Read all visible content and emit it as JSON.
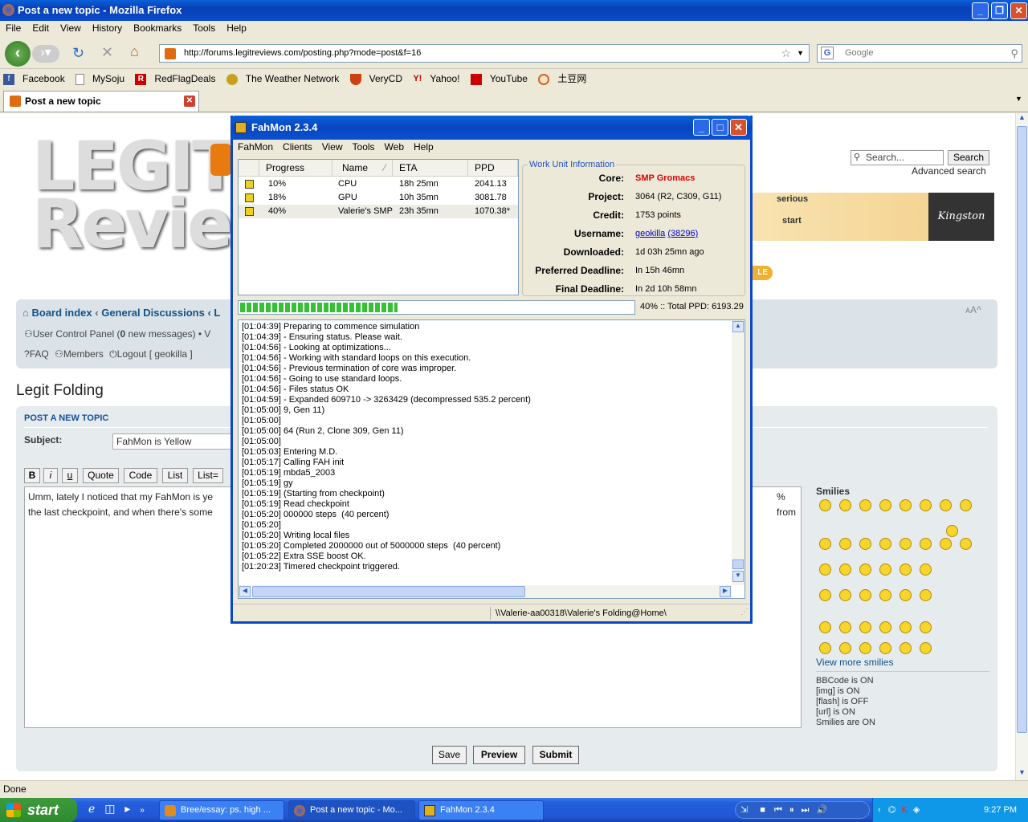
{
  "browser": {
    "title": "Post a new topic - Mozilla Firefox",
    "menu": [
      "File",
      "Edit",
      "View",
      "History",
      "Bookmarks",
      "Tools",
      "Help"
    ],
    "url": "http://forums.legitreviews.com/posting.php?mode=post&f=16",
    "search_placeholder": "Google",
    "bookmarks": [
      "Facebook",
      "MySoju",
      "RedFlagDeals",
      "The Weather Network",
      "VeryCD",
      "Yahoo!",
      "YouTube",
      "土豆网"
    ],
    "tab": "Post a new topic",
    "status": "Done"
  },
  "page": {
    "search_placeholder": "Search...",
    "search_button": "Search",
    "advanced_search": "Advanced search",
    "breadcrumb_board": "Board index",
    "breadcrumb_sep": "‹",
    "breadcrumb_general": "General Discussions",
    "breadcrumb_tail": "‹ L",
    "ucp_prefix": "User Control Panel (",
    "ucp_count": "0",
    "ucp_suffix": " new messages) • V",
    "faq": "FAQ",
    "members": "Members",
    "logout": "Logout [ geokilla ]",
    "forum_title": "Legit Folding",
    "post_heading": "POST A NEW TOPIC",
    "subject_label": "Subject:",
    "subject_value": "FahMon is Yellow",
    "bbcode_buttons": [
      "B",
      "i",
      "u",
      "Quote",
      "Code",
      "List",
      "List="
    ],
    "message_line1": "Umm, lately I noticed that my FahMon is ye",
    "message_line1_right": "% from",
    "message_line2": "the last checkpoint, and when there's some",
    "smilies_title": "Smilies",
    "view_more_smilies": "View more smilies",
    "bbcode_status": "BBCode is ON",
    "img_status": "[img] is ON",
    "flash_status": "[flash] is OFF",
    "url_status": "[url] is ON",
    "smilies_status": "Smilies are ON",
    "save": "Save",
    "preview": "Preview",
    "submit": "Submit",
    "ad_text1": "serious",
    "ad_text2": "start",
    "ad_brand": "Kingston"
  },
  "fahmon": {
    "title": "FahMon 2.3.4",
    "menu": [
      "FahMon",
      "Clients",
      "View",
      "Tools",
      "Web",
      "Help"
    ],
    "columns": [
      "Progress",
      "Name",
      "ETA",
      "PPD"
    ],
    "clients": [
      {
        "progress": "10%",
        "name": "CPU",
        "eta": "18h 25mn",
        "ppd": "2041.13"
      },
      {
        "progress": "18%",
        "name": "GPU",
        "eta": "10h 35mn",
        "ppd": "3081.78"
      },
      {
        "progress": "40%",
        "name": "Valerie's SMP",
        "eta": "23h 35mn",
        "ppd": "1070.38*"
      }
    ],
    "wu_title": "Work Unit Information",
    "wu": [
      {
        "label": "Core:",
        "value": "SMP Gromacs"
      },
      {
        "label": "Project:",
        "value": "3064 (R2, C309, G11)"
      },
      {
        "label": "Credit:",
        "value": "1753 points"
      },
      {
        "label": "Username:",
        "value": "geokilla",
        "extra": "(38296)"
      },
      {
        "label": "Downloaded:",
        "value": "1d 03h 25mn ago"
      },
      {
        "label": "Preferred Deadline:",
        "value": "In 15h 46mn"
      },
      {
        "label": "Final Deadline:",
        "value": "In 2d 10h 58mn"
      }
    ],
    "progress_fraction": 0.4,
    "progress_text": "40% :: Total PPD: 6193.29",
    "log": "[01:04:39] Preparing to commence simulation\n[01:04:39] - Ensuring status. Please wait.\n[01:04:56] - Looking at optimizations...\n[01:04:56] - Working with standard loops on this execution.\n[01:04:56] - Previous termination of core was improper.\n[01:04:56] - Going to use standard loops.\n[01:04:56] - Files status OK\n[01:04:59] - Expanded 609710 -> 3263429 (decompressed 535.2 percent)\n[01:05:00] 9, Gen 11)\n[01:05:00]\n[01:05:00] 64 (Run 2, Clone 309, Gen 11)\n[01:05:00]\n[01:05:03] Entering M.D.\n[01:05:17] Calling FAH init\n[01:05:19] mbda5_2003\n[01:05:19] gy\n[01:05:19] (Starting from checkpoint)\n[01:05:19] Read checkpoint\n[01:05:20] 000000 steps  (40 percent)\n[01:05:20]\n[01:05:20] Writing local files\n[01:05:20] Completed 2000000 out of 5000000 steps  (40 percent)\n[01:05:22] Extra SSE boost OK.\n[01:20:23] Timered checkpoint triggered.",
    "status_path": "\\\\Valerie-aa00318\\Valerie's Folding@Home\\"
  },
  "taskbar": {
    "start": "start",
    "tasks": [
      "Bree/essay: ps. high ...",
      "Post a new topic - Mo...",
      "FahMon 2.3.4"
    ],
    "clock": "9:27 PM"
  }
}
